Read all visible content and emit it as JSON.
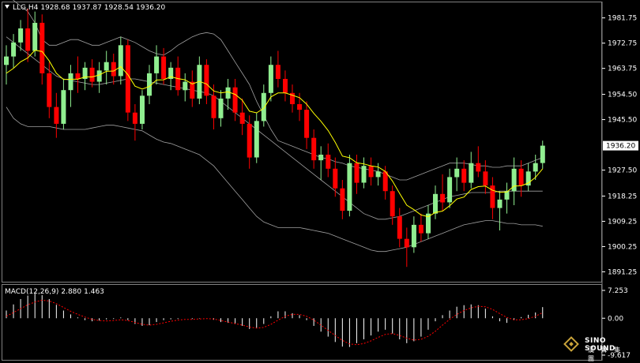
{
  "header": {
    "symbol": "LLG,H4",
    "open": "1928.68",
    "high": "1937.87",
    "low": "1928.54",
    "close": "1936.20"
  },
  "macd_header": {
    "label": "MACD(12,26,9)",
    "macd": "2.880",
    "signal": "1.463"
  },
  "logo": {
    "name": "SINO SOUND",
    "chinese": "漢 聲 集 團"
  },
  "colors": {
    "bull": "#90ee90",
    "bear": "#ff0000",
    "ma": "#ffff00",
    "bands": "#a0a0a0",
    "axis": "#ffffff",
    "signal": "#ff0000",
    "hist": "#ffffff"
  },
  "chart_data": [
    {
      "type": "candlestick",
      "title": "LLG,H4",
      "y_axis_labels": [
        "1981.75",
        "1972.75",
        "1963.75",
        "1954.50",
        "1945.50",
        "1927.50",
        "1918.25",
        "1909.25",
        "1900.25",
        "1891.25"
      ],
      "current_price": "1936.20",
      "ylim": [
        1888,
        1987
      ],
      "grid": false,
      "overlays": [
        "moving average (yellow)",
        "Bollinger bands (grey)"
      ],
      "candles": [
        [
          1965.0,
          1972.0,
          1958.0,
          1968.0
        ],
        [
          1968.0,
          1976.0,
          1964.0,
          1973.0
        ],
        [
          1973.0,
          1981.0,
          1970.0,
          1978.0
        ],
        [
          1978.0,
          1985.0,
          1966.0,
          1970.0
        ],
        [
          1970.0,
          1984.0,
          1968.0,
          1980.0
        ],
        [
          1980.0,
          1983.0,
          1958.0,
          1962.0
        ],
        [
          1962.0,
          1966.0,
          1946.0,
          1950.0
        ],
        [
          1950.0,
          1955.0,
          1939.0,
          1944.0
        ],
        [
          1944.0,
          1960.0,
          1942.0,
          1956.0
        ],
        [
          1956.0,
          1965.0,
          1950.0,
          1962.0
        ],
        [
          1962.0,
          1968.0,
          1955.0,
          1960.0
        ],
        [
          1960.0,
          1966.0,
          1956.0,
          1964.0
        ],
        [
          1964.0,
          1967.0,
          1957.0,
          1959.0
        ],
        [
          1959.0,
          1966.0,
          1955.0,
          1963.0
        ],
        [
          1963.0,
          1970.0,
          1958.0,
          1966.0
        ],
        [
          1966.0,
          1969.0,
          1958.0,
          1961.0
        ],
        [
          1961.0,
          1975.0,
          1958.0,
          1972.0
        ],
        [
          1972.0,
          1974.0,
          1945.0,
          1948.0
        ],
        [
          1948.0,
          1951.0,
          1938.0,
          1944.0
        ],
        [
          1944.0,
          1956.0,
          1942.0,
          1954.0
        ],
        [
          1954.0,
          1965.0,
          1951.0,
          1962.0
        ],
        [
          1962.0,
          1972.0,
          1958.0,
          1968.0
        ],
        [
          1968.0,
          1971.0,
          1958.0,
          1960.0
        ],
        [
          1960.0,
          1966.0,
          1956.0,
          1964.0
        ],
        [
          1964.0,
          1968.0,
          1954.0,
          1956.0
        ],
        [
          1956.0,
          1962.0,
          1952.0,
          1959.0
        ],
        [
          1959.0,
          1963.0,
          1950.0,
          1953.0
        ],
        [
          1953.0,
          1968.0,
          1951.0,
          1965.0
        ],
        [
          1965.0,
          1967.0,
          1951.0,
          1954.0
        ],
        [
          1954.0,
          1958.0,
          1942.0,
          1946.0
        ],
        [
          1946.0,
          1956.0,
          1943.0,
          1953.0
        ],
        [
          1953.0,
          1960.0,
          1949.0,
          1957.0
        ],
        [
          1957.0,
          1960.0,
          1945.0,
          1948.0
        ],
        [
          1948.0,
          1953.0,
          1940.0,
          1944.0
        ],
        [
          1944.0,
          1947.0,
          1928.0,
          1932.0
        ],
        [
          1932.0,
          1948.0,
          1930.0,
          1945.0
        ],
        [
          1945.0,
          1958.0,
          1943.0,
          1955.0
        ],
        [
          1955.0,
          1968.0,
          1952.0,
          1965.0
        ],
        [
          1965.0,
          1970.0,
          1957.0,
          1960.0
        ],
        [
          1960.0,
          1963.0,
          1952.0,
          1955.0
        ],
        [
          1955.0,
          1958.0,
          1948.0,
          1951.0
        ],
        [
          1951.0,
          1955.0,
          1945.0,
          1949.0
        ],
        [
          1949.0,
          1952.0,
          1935.0,
          1939.0
        ],
        [
          1939.0,
          1942.0,
          1928.0,
          1931.0
        ],
        [
          1931.0,
          1936.0,
          1924.0,
          1933.0
        ],
        [
          1933.0,
          1937.0,
          1925.0,
          1928.0
        ],
        [
          1928.0,
          1932.0,
          1918.0,
          1921.0
        ],
        [
          1921.0,
          1924.0,
          1910.0,
          1913.0
        ],
        [
          1913.0,
          1933.0,
          1911.0,
          1930.0
        ],
        [
          1930.0,
          1933.0,
          1919.0,
          1923.0
        ],
        [
          1923.0,
          1932.0,
          1921.0,
          1929.0
        ],
        [
          1929.0,
          1932.0,
          1922.0,
          1925.0
        ],
        [
          1925.0,
          1930.0,
          1922.0,
          1927.0
        ],
        [
          1927.0,
          1929.0,
          1917.0,
          1920.0
        ],
        [
          1920.0,
          1922.0,
          1908.0,
          1911.0
        ],
        [
          1911.0,
          1914.0,
          1900.0,
          1903.0
        ],
        [
          1903.0,
          1907.0,
          1893.0,
          1900.0
        ],
        [
          1900.0,
          1911.0,
          1898.0,
          1908.0
        ],
        [
          1908.0,
          1912.0,
          1902.0,
          1905.0
        ],
        [
          1905.0,
          1915.0,
          1903.0,
          1912.0
        ],
        [
          1912.0,
          1922.0,
          1910.0,
          1919.0
        ],
        [
          1919.0,
          1926.0,
          1913.0,
          1916.0
        ],
        [
          1916.0,
          1928.0,
          1914.0,
          1925.0
        ],
        [
          1925.0,
          1932.0,
          1920.0,
          1928.0
        ],
        [
          1928.0,
          1931.0,
          1920.0,
          1923.0
        ],
        [
          1923.0,
          1934.0,
          1921.0,
          1930.0
        ],
        [
          1930.0,
          1936.0,
          1925.0,
          1927.0
        ],
        [
          1927.0,
          1931.0,
          1919.0,
          1922.0
        ],
        [
          1922.0,
          1925.0,
          1910.0,
          1914.0
        ],
        [
          1914.0,
          1920.0,
          1906.0,
          1917.0
        ],
        [
          1917.0,
          1923.0,
          1912.0,
          1920.0
        ],
        [
          1920.0,
          1932.0,
          1915.0,
          1928.0
        ],
        [
          1928.0,
          1931.0,
          1918.0,
          1922.0
        ],
        [
          1922.0,
          1930.0,
          1920.0,
          1927.0
        ],
        [
          1927.0,
          1933.0,
          1924.0,
          1930.0
        ],
        [
          1930.0,
          1938.0,
          1928.0,
          1936.2
        ]
      ],
      "ma": [
        1962.0,
        1963.8,
        1966.1,
        1967.5,
        1970.2,
        1969.8,
        1966.4,
        1962.0,
        1959.8,
        1959.9,
        1959.9,
        1960.7,
        1960.7,
        1961.4,
        1962.7,
        1962.8,
        1964.4,
        1961.5,
        1957.4,
        1956.4,
        1957.3,
        1959.6,
        1959.7,
        1960.8,
        1960.1,
        1959.7,
        1958.2,
        1959.1,
        1958.2,
        1955.7,
        1955.0,
        1955.4,
        1954.5,
        1952.4,
        1948.5,
        1947.9,
        1949.5,
        1953.6,
        1955.0,
        1955.0,
        1954.2,
        1953.3,
        1951.0,
        1947.7,
        1944.9,
        1941.6,
        1937.4,
        1932.5,
        1931.9,
        1930.1,
        1929.7,
        1929.0,
        1928.6,
        1927.0,
        1923.6,
        1919.2,
        1915.0,
        1913.4,
        1911.5,
        1910.9,
        1912.4,
        1912.9,
        1914.8,
        1917.2,
        1917.9,
        1920.6,
        1921.6,
        1921.8,
        1920.3,
        1919.6,
        1919.7,
        1921.8,
        1921.9,
        1922.9,
        1924.9,
        1928.0
      ],
      "bands": {
        "upper": [
          1990.0,
          1988.0,
          1986.0,
          1984.0,
          1980.0,
          1974.0,
          1972.0,
          1972.0,
          1973.0,
          1974.0,
          1974.0,
          1973.0,
          1972.0,
          1972.0,
          1973.0,
          1974.0,
          1975.0,
          1974.0,
          1973.0,
          1971.5,
          1970.0,
          1969.0,
          1968.5,
          1970.0,
          1972.0,
          1973.5,
          1975.0,
          1976.0,
          1976.5,
          1976.0,
          1974.0,
          1970.0,
          1966.0,
          1962.0,
          1958.0,
          1952.0,
          1947.0,
          1942.0,
          1938.0,
          1937.0,
          1936.0,
          1935.0,
          1934.0,
          1933.0,
          1932.0,
          1931.5,
          1930.5,
          1930.0,
          1929.0,
          1928.5,
          1928.0,
          1927.5,
          1927.0,
          1926.0,
          1925.0,
          1924.0,
          1924.0,
          1925.0,
          1926.0,
          1927.0,
          1928.0,
          1929.0,
          1930.0,
          1930.0,
          1930.0,
          1929.5,
          1929.0,
          1929.0,
          1928.5,
          1928.5,
          1929.0,
          1929.0,
          1929.0,
          1930.0,
          1931.0,
          1932.0
        ],
        "middle": [
          1975.0,
          1973.0,
          1971.0,
          1969.0,
          1967.0,
          1965.0,
          1963.0,
          1961.0,
          1960.0,
          1959.5,
          1959.0,
          1958.5,
          1958.0,
          1958.0,
          1958.5,
          1959.0,
          1959.5,
          1960.0,
          1960.0,
          1959.5,
          1959.0,
          1958.5,
          1958.0,
          1957.5,
          1957.0,
          1956.5,
          1956.0,
          1955.5,
          1955.0,
          1954.0,
          1952.0,
          1950.0,
          1948.0,
          1946.0,
          1944.0,
          1942.0,
          1940.0,
          1938.0,
          1936.0,
          1934.0,
          1932.0,
          1930.0,
          1928.0,
          1926.0,
          1924.0,
          1922.0,
          1920.0,
          1918.0,
          1916.0,
          1914.0,
          1912.0,
          1911.0,
          1910.0,
          1910.0,
          1910.5,
          1911.0,
          1912.0,
          1913.0,
          1914.0,
          1915.0,
          1916.0,
          1917.0,
          1918.0,
          1918.5,
          1919.0,
          1919.5,
          1919.5,
          1919.5,
          1919.5,
          1920.0,
          1920.0,
          1920.0,
          1920.0,
          1920.0,
          1920.0,
          1920.0
        ],
        "lower": [
          1950.0,
          1946.0,
          1944.0,
          1943.0,
          1943.0,
          1943.0,
          1943.0,
          1942.5,
          1942.0,
          1942.0,
          1942.0,
          1942.0,
          1942.5,
          1943.0,
          1943.5,
          1943.5,
          1943.0,
          1942.5,
          1942.0,
          1941.5,
          1940.0,
          1938.5,
          1937.5,
          1937.0,
          1936.0,
          1935.0,
          1934.0,
          1933.0,
          1931.0,
          1929.0,
          1926.0,
          1923.0,
          1920.0,
          1917.0,
          1914.0,
          1911.0,
          1909.0,
          1908.0,
          1907.0,
          1907.0,
          1907.0,
          1907.0,
          1906.5,
          1906.0,
          1905.5,
          1905.0,
          1904.0,
          1903.0,
          1902.0,
          1901.0,
          1900.0,
          1899.0,
          1898.5,
          1898.5,
          1899.0,
          1899.5,
          1900.0,
          1901.0,
          1902.0,
          1903.0,
          1904.0,
          1905.0,
          1906.0,
          1907.0,
          1908.0,
          1908.5,
          1909.0,
          1909.5,
          1909.5,
          1909.0,
          1908.5,
          1908.5,
          1908.0,
          1908.0,
          1908.0,
          1907.5
        ]
      }
    },
    {
      "type": "bar",
      "title": "MACD(12,26,9)",
      "y_axis_labels": [
        "7.253",
        "0.00",
        "-9.617"
      ],
      "ylim": [
        -9.617,
        7.253
      ],
      "histogram": [
        2.0,
        3.6,
        5.0,
        5.9,
        6.5,
        6.0,
        5.0,
        3.5,
        2.0,
        1.0,
        0.2,
        -0.5,
        -0.8,
        -0.6,
        -0.3,
        -0.2,
        0.2,
        -0.5,
        -1.5,
        -2.0,
        -1.8,
        -1.0,
        -0.5,
        -0.3,
        -0.2,
        0.0,
        -0.2,
        -0.1,
        0.0,
        -0.4,
        -1.0,
        -1.2,
        -1.5,
        -2.0,
        -2.8,
        -2.5,
        -1.5,
        0.5,
        1.8,
        1.8,
        1.3,
        0.8,
        -0.5,
        -2.0,
        -3.5,
        -4.8,
        -6.2,
        -7.4,
        -7.5,
        -6.5,
        -5.5,
        -4.5,
        -3.5,
        -3.0,
        -4.0,
        -5.5,
        -6.5,
        -6.0,
        -4.8,
        -3.0,
        -0.8,
        0.8,
        2.0,
        3.0,
        3.4,
        3.6,
        3.4,
        2.5,
        0.5,
        -0.8,
        -1.2,
        -0.5,
        0.3,
        0.9,
        1.5,
        2.9
      ],
      "signal": [
        0.5,
        1.5,
        2.5,
        3.5,
        4.2,
        4.7,
        4.5,
        3.8,
        2.8,
        1.8,
        1.0,
        0.3,
        -0.3,
        -0.6,
        -0.7,
        -0.6,
        -0.4,
        -0.6,
        -1.1,
        -1.6,
        -1.8,
        -1.6,
        -1.2,
        -0.8,
        -0.5,
        -0.3,
        -0.3,
        -0.2,
        -0.1,
        -0.2,
        -0.6,
        -1.0,
        -1.4,
        -1.8,
        -2.3,
        -2.6,
        -2.4,
        -1.6,
        -0.5,
        0.5,
        1.0,
        1.0,
        0.5,
        -0.5,
        -1.8,
        -3.2,
        -4.5,
        -5.8,
        -6.7,
        -6.9,
        -6.6,
        -5.9,
        -5.0,
        -4.2,
        -4.0,
        -4.5,
        -5.2,
        -5.7,
        -5.5,
        -4.7,
        -3.4,
        -1.8,
        -0.3,
        1.0,
        2.0,
        2.7,
        3.1,
        3.0,
        2.3,
        1.2,
        0.2,
        -0.4,
        -0.4,
        -0.1,
        0.5,
        1.463
      ]
    }
  ]
}
